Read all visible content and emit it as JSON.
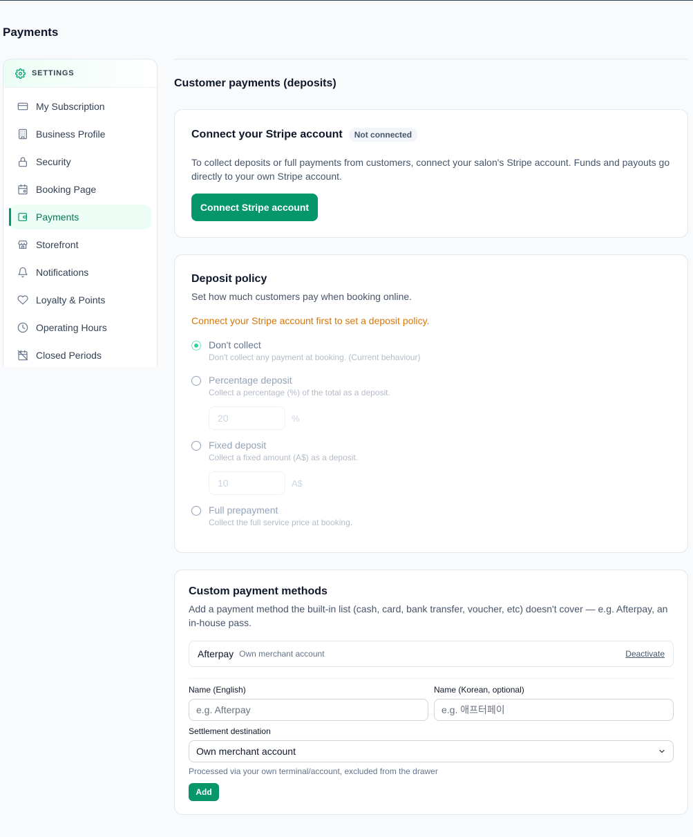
{
  "page": {
    "title": "Payments"
  },
  "sidebar": {
    "header": {
      "label": "SETTINGS",
      "icon": "gear-icon"
    },
    "items": [
      {
        "label": "My Subscription",
        "icon": "credit-card-icon",
        "active": false
      },
      {
        "label": "Business Profile",
        "icon": "building-icon",
        "active": false
      },
      {
        "label": "Security",
        "icon": "lock-icon",
        "active": false
      },
      {
        "label": "Booking Page",
        "icon": "calendar-icon",
        "active": false
      },
      {
        "label": "Payments",
        "icon": "wallet-icon",
        "active": true
      },
      {
        "label": "Storefront",
        "icon": "store-icon",
        "active": false
      },
      {
        "label": "Notifications",
        "icon": "bell-icon",
        "active": false
      },
      {
        "label": "Loyalty & Points",
        "icon": "heart-icon",
        "active": false
      },
      {
        "label": "Operating Hours",
        "icon": "clock-icon",
        "active": false
      },
      {
        "label": "Closed Periods",
        "icon": "calendar-off-icon",
        "active": false
      }
    ]
  },
  "main": {
    "section_title": "Customer payments (deposits)",
    "stripe": {
      "title": "Connect your Stripe account",
      "status": "Not connected",
      "description": "To collect deposits or full payments from customers, connect your salon's Stripe account. Funds and payouts go directly to your own Stripe account.",
      "button": "Connect Stripe account"
    },
    "deposit": {
      "title": "Deposit policy",
      "subtitle": "Set how much customers pay when booking online.",
      "warning": "Connect your Stripe account first to set a deposit policy.",
      "options": [
        {
          "label": "Don't collect",
          "desc": "Don't collect any payment at booking. (Current behaviour)",
          "checked": true
        },
        {
          "label": "Percentage deposit",
          "desc": "Collect a percentage (%) of the total as a deposit.",
          "checked": false,
          "value": "20",
          "unit": "%"
        },
        {
          "label": "Fixed deposit",
          "desc": "Collect a fixed amount (A$) as a deposit.",
          "checked": false,
          "value": "10",
          "unit": "A$"
        },
        {
          "label": "Full prepayment",
          "desc": "Collect the full service price at booking.",
          "checked": false
        }
      ]
    },
    "custom": {
      "title": "Custom payment methods",
      "description": "Add a payment method the built-in list (cash, card, bank transfer, voucher, etc) doesn't cover — e.g. Afterpay, an in-house pass.",
      "methods": [
        {
          "name": "Afterpay",
          "destination": "Own merchant account",
          "action": "Deactivate"
        }
      ],
      "form": {
        "name_en_label": "Name (English)",
        "name_en_placeholder": "e.g. Afterpay",
        "name_ko_label": "Name (Korean, optional)",
        "name_ko_placeholder": "e.g. 애프터페이",
        "settlement_label": "Settlement destination",
        "settlement_value": "Own merchant account",
        "settlement_helper": "Processed via your own terminal/account, excluded from the drawer",
        "add_button": "Add"
      }
    }
  }
}
